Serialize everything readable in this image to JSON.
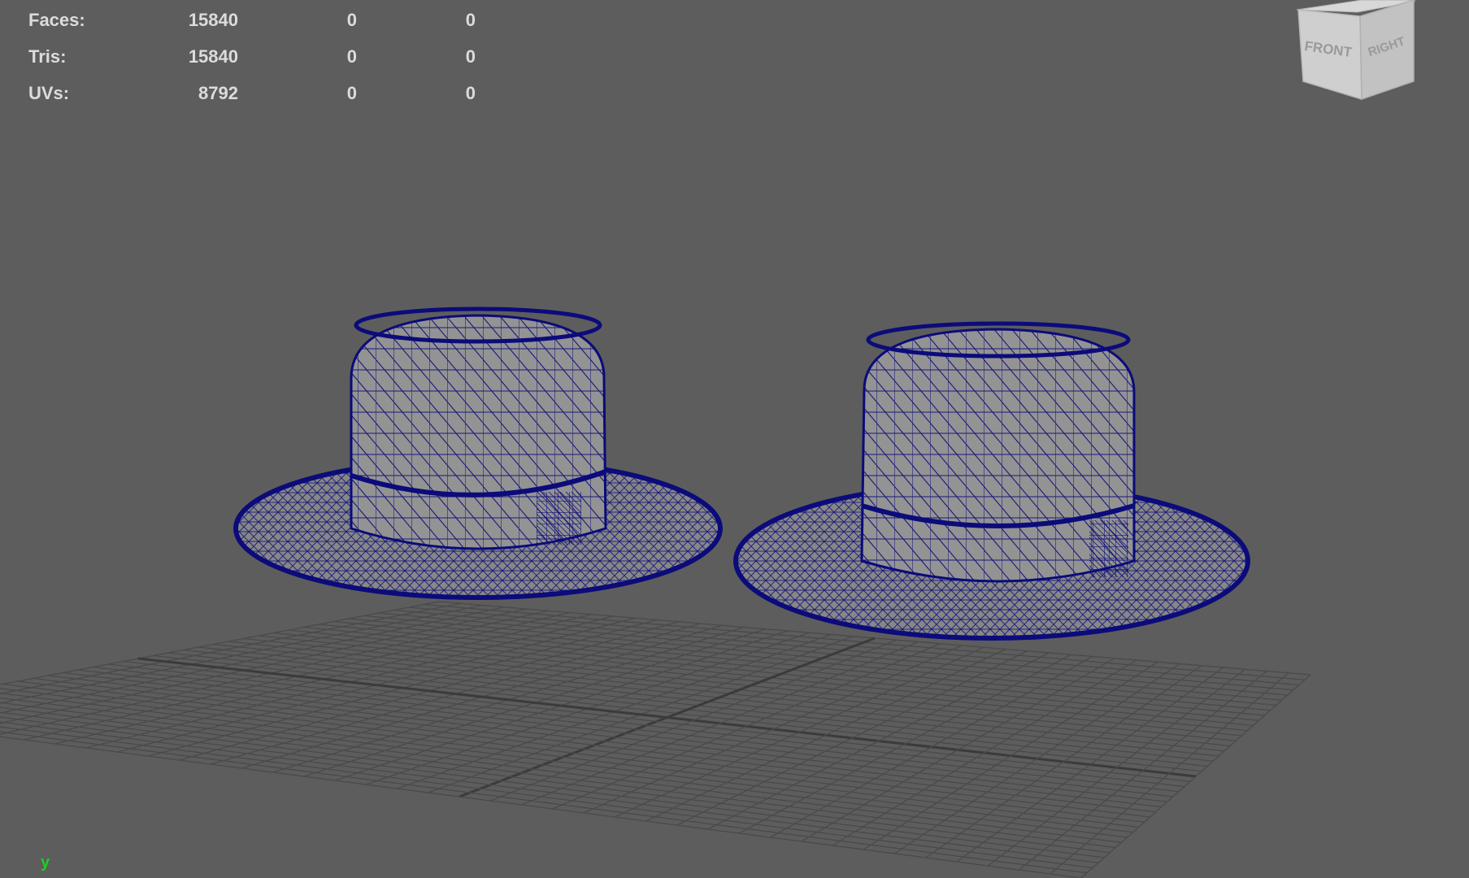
{
  "hud": {
    "rows": [
      {
        "label": "Faces:",
        "values": [
          "15840",
          "0",
          "0"
        ]
      },
      {
        "label": "Tris:",
        "values": [
          "15840",
          "0",
          "0"
        ]
      },
      {
        "label": "UVs:",
        "values": [
          "8792",
          "0",
          "0"
        ]
      }
    ]
  },
  "viewcube": {
    "front_label": "FRONT",
    "right_label": "RIGHT"
  },
  "axis": {
    "y_label": "y"
  },
  "colors": {
    "background": "#5d5d5d",
    "grid": "#4a4a4a",
    "grid_axis": "#3b3b3b",
    "wireframe": "#0b0b7a",
    "hat_fill": "#8e8e8e",
    "hud_text": "#dcdcdc",
    "y_axis": "#19d11f"
  },
  "objects": [
    {
      "name": "hat",
      "type": "polygon-mesh",
      "display": "wireframe-on-shaded"
    },
    {
      "name": "hat",
      "type": "polygon-mesh",
      "display": "wireframe-on-shaded"
    }
  ]
}
